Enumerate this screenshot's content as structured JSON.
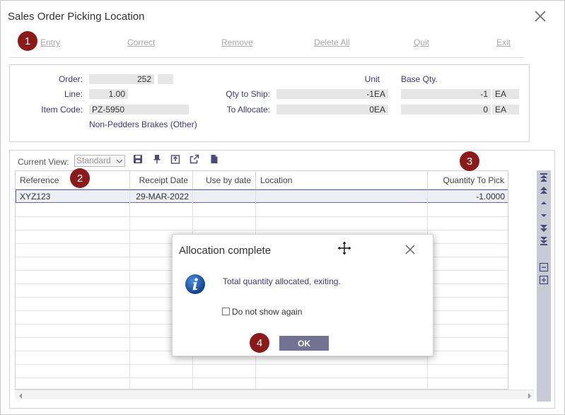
{
  "window": {
    "title": "Sales Order Picking Location"
  },
  "toolbar": {
    "entry": "Entry",
    "correct": "Correct",
    "remove": "Remove",
    "delete_all": "Delete All",
    "quit": "Quit",
    "exit": "Exit"
  },
  "badges": {
    "b1": "1",
    "b2": "2",
    "b3": "3",
    "b4": "4"
  },
  "header": {
    "order_label": "Order:",
    "order_value": "252",
    "line_label": "Line:",
    "line_value": "1.00",
    "item_code_label": "Item Code:",
    "item_code_value": "PZ-5950",
    "item_desc": "Non-Pedders Brakes (Other)",
    "unit_label": "Unit",
    "base_qty_label": "Base Qty.",
    "qty_to_ship_label": "Qty to Ship:",
    "qty_to_ship_unit": "-1EA",
    "qty_to_ship_base": "-1",
    "qty_to_ship_base_uom": "EA",
    "to_allocate_label": "To Allocate:",
    "to_allocate_unit": "0EA",
    "to_allocate_base": "0",
    "to_allocate_base_uom": "EA"
  },
  "grid": {
    "current_view_label": "Current View:",
    "current_view_value": "Standard",
    "columns": [
      "Reference",
      "Receipt Date",
      "Use by date",
      "Location",
      "Quantity To Pick"
    ],
    "rows": [
      {
        "reference": "XYZ123",
        "receipt_date": "29-MAR-2022",
        "use_by_date": "",
        "location": "",
        "quantity": "-1.0000"
      }
    ]
  },
  "dialog": {
    "title": "Allocation complete",
    "message": "Total quantity allocated, exiting.",
    "checkbox_label": "Do not show again",
    "ok_label": "OK"
  },
  "colors": {
    "badge": "#8b1a1a",
    "ok_button": "#747293",
    "label_text": "#3a3a7a",
    "field_bg": "#e6e6e6"
  }
}
